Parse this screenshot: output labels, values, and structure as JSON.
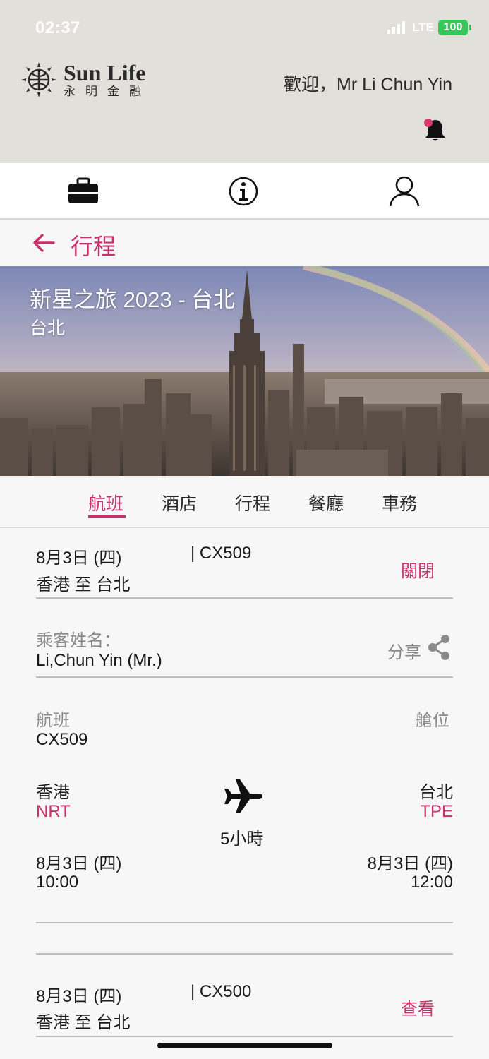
{
  "status_bar": {
    "time": "02:37",
    "network": "LTE",
    "battery": "100"
  },
  "header": {
    "logo_en": "Sun Life",
    "logo_zh": "永明金融",
    "welcome": "歡迎，Mr Li Chun Yin"
  },
  "page": {
    "back_title": "行程"
  },
  "hero": {
    "title": "新星之旅 2023 - 台北",
    "subtitle": "台北"
  },
  "tabs": [
    {
      "label": "航班",
      "active": true
    },
    {
      "label": "酒店",
      "active": false
    },
    {
      "label": "行程",
      "active": false
    },
    {
      "label": "餐廳",
      "active": false
    },
    {
      "label": "車務",
      "active": false
    }
  ],
  "flight1": {
    "date": "8月3日 (四)",
    "flight_no": "| CX509",
    "route": "香港 至 台北",
    "action": "關閉",
    "passenger_label": "乘客姓名：",
    "passenger_name": "Li,Chun Yin (Mr.)",
    "share_label": "分享",
    "flight_label": "航班",
    "flight_value": "CX509",
    "cabin_label": "艙位",
    "origin_city": "香港",
    "origin_code": "NRT",
    "dest_city": "台北",
    "dest_code": "TPE",
    "duration": "5小時",
    "depart_date": "8月3日 (四)",
    "depart_time": "10:00",
    "arrive_date": "8月3日 (四)",
    "arrive_time": "12:00"
  },
  "flight2": {
    "date": "8月3日 (四)",
    "flight_no": "| CX500",
    "route": "香港 至 台北",
    "action": "查看"
  },
  "colors": {
    "accent": "#c8316a",
    "header_bg": "#e2e0da",
    "battery": "#35c759"
  },
  "icons": [
    "briefcase-icon",
    "info-icon",
    "user-icon",
    "bell-icon",
    "back-arrow-icon",
    "share-icon",
    "airplane-icon"
  ]
}
